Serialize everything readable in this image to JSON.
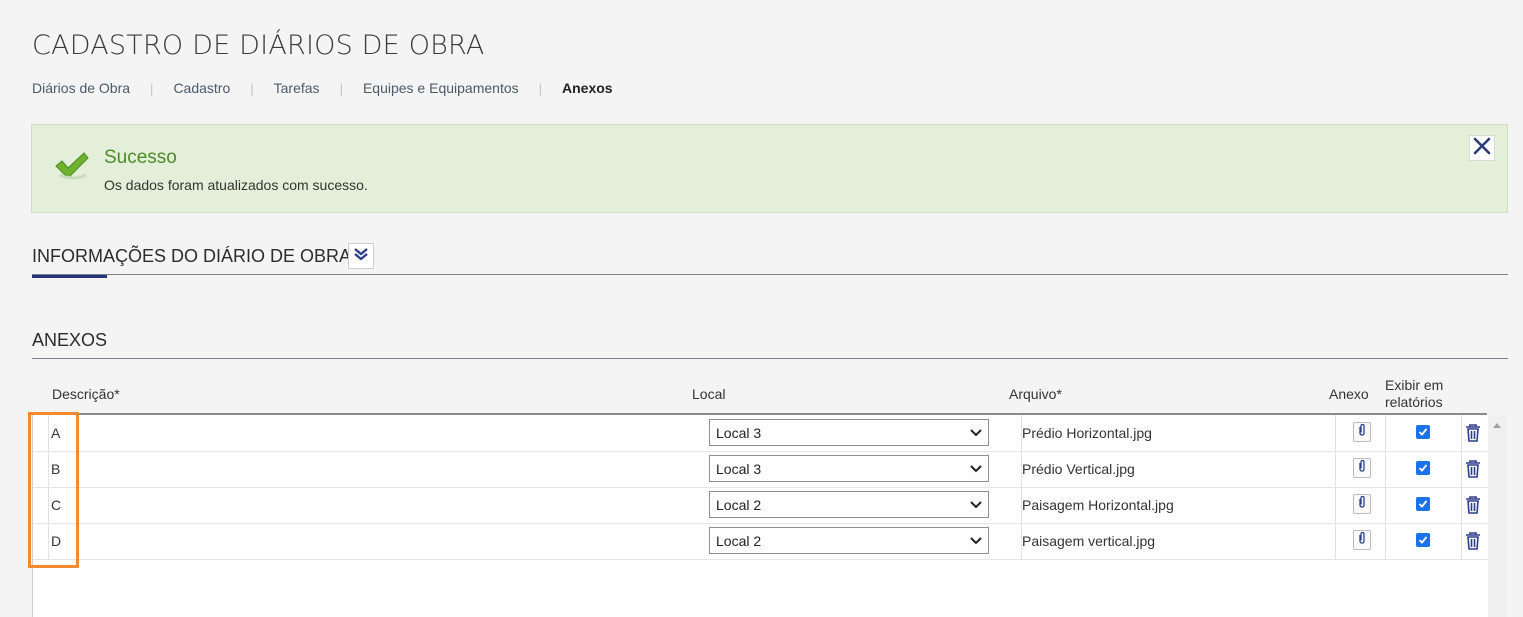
{
  "page": {
    "title": "CADASTRO DE DIÁRIOS DE OBRA"
  },
  "breadcrumb": [
    {
      "label": "Diários de Obra",
      "active": false
    },
    {
      "label": "Cadastro",
      "active": false
    },
    {
      "label": "Tarefas",
      "active": false
    },
    {
      "label": "Equipes e Equipamentos",
      "active": false
    },
    {
      "label": "Anexos",
      "active": true
    }
  ],
  "alert": {
    "icon": "check-icon",
    "title": "Sucesso",
    "message": "Os dados foram atualizados com sucesso.",
    "close_icon": "close-icon",
    "color": "#4d8a2a",
    "background": "#e3efd8"
  },
  "info_section": {
    "title": "INFORMAÇÕES DO DIÁRIO DE OBRA",
    "expand_icon": "double-chevron-down-icon"
  },
  "anexos_section": {
    "title": "ANEXOS",
    "columns": {
      "descricao": "Descrição*",
      "local": "Local",
      "arquivo": "Arquivo*",
      "anexo": "Anexo",
      "exibir": "Exibir em relatórios"
    },
    "rows": [
      {
        "descricao": "A",
        "local": "Local 3",
        "arquivo": "Prédio Horizontal.jpg",
        "exibir": true
      },
      {
        "descricao": "B",
        "local": "Local 3",
        "arquivo": "Prédio Vertical.jpg",
        "exibir": true
      },
      {
        "descricao": "C",
        "local": "Local 2",
        "arquivo": "Paisagem Horizontal.jpg",
        "exibir": true
      },
      {
        "descricao": "D",
        "local": "Local 2",
        "arquivo": "Paisagem vertical.jpg",
        "exibir": true
      }
    ]
  },
  "colors": {
    "accent": "#25357a",
    "checkbox": "#1a73e8",
    "highlight": "#f28a2e"
  }
}
